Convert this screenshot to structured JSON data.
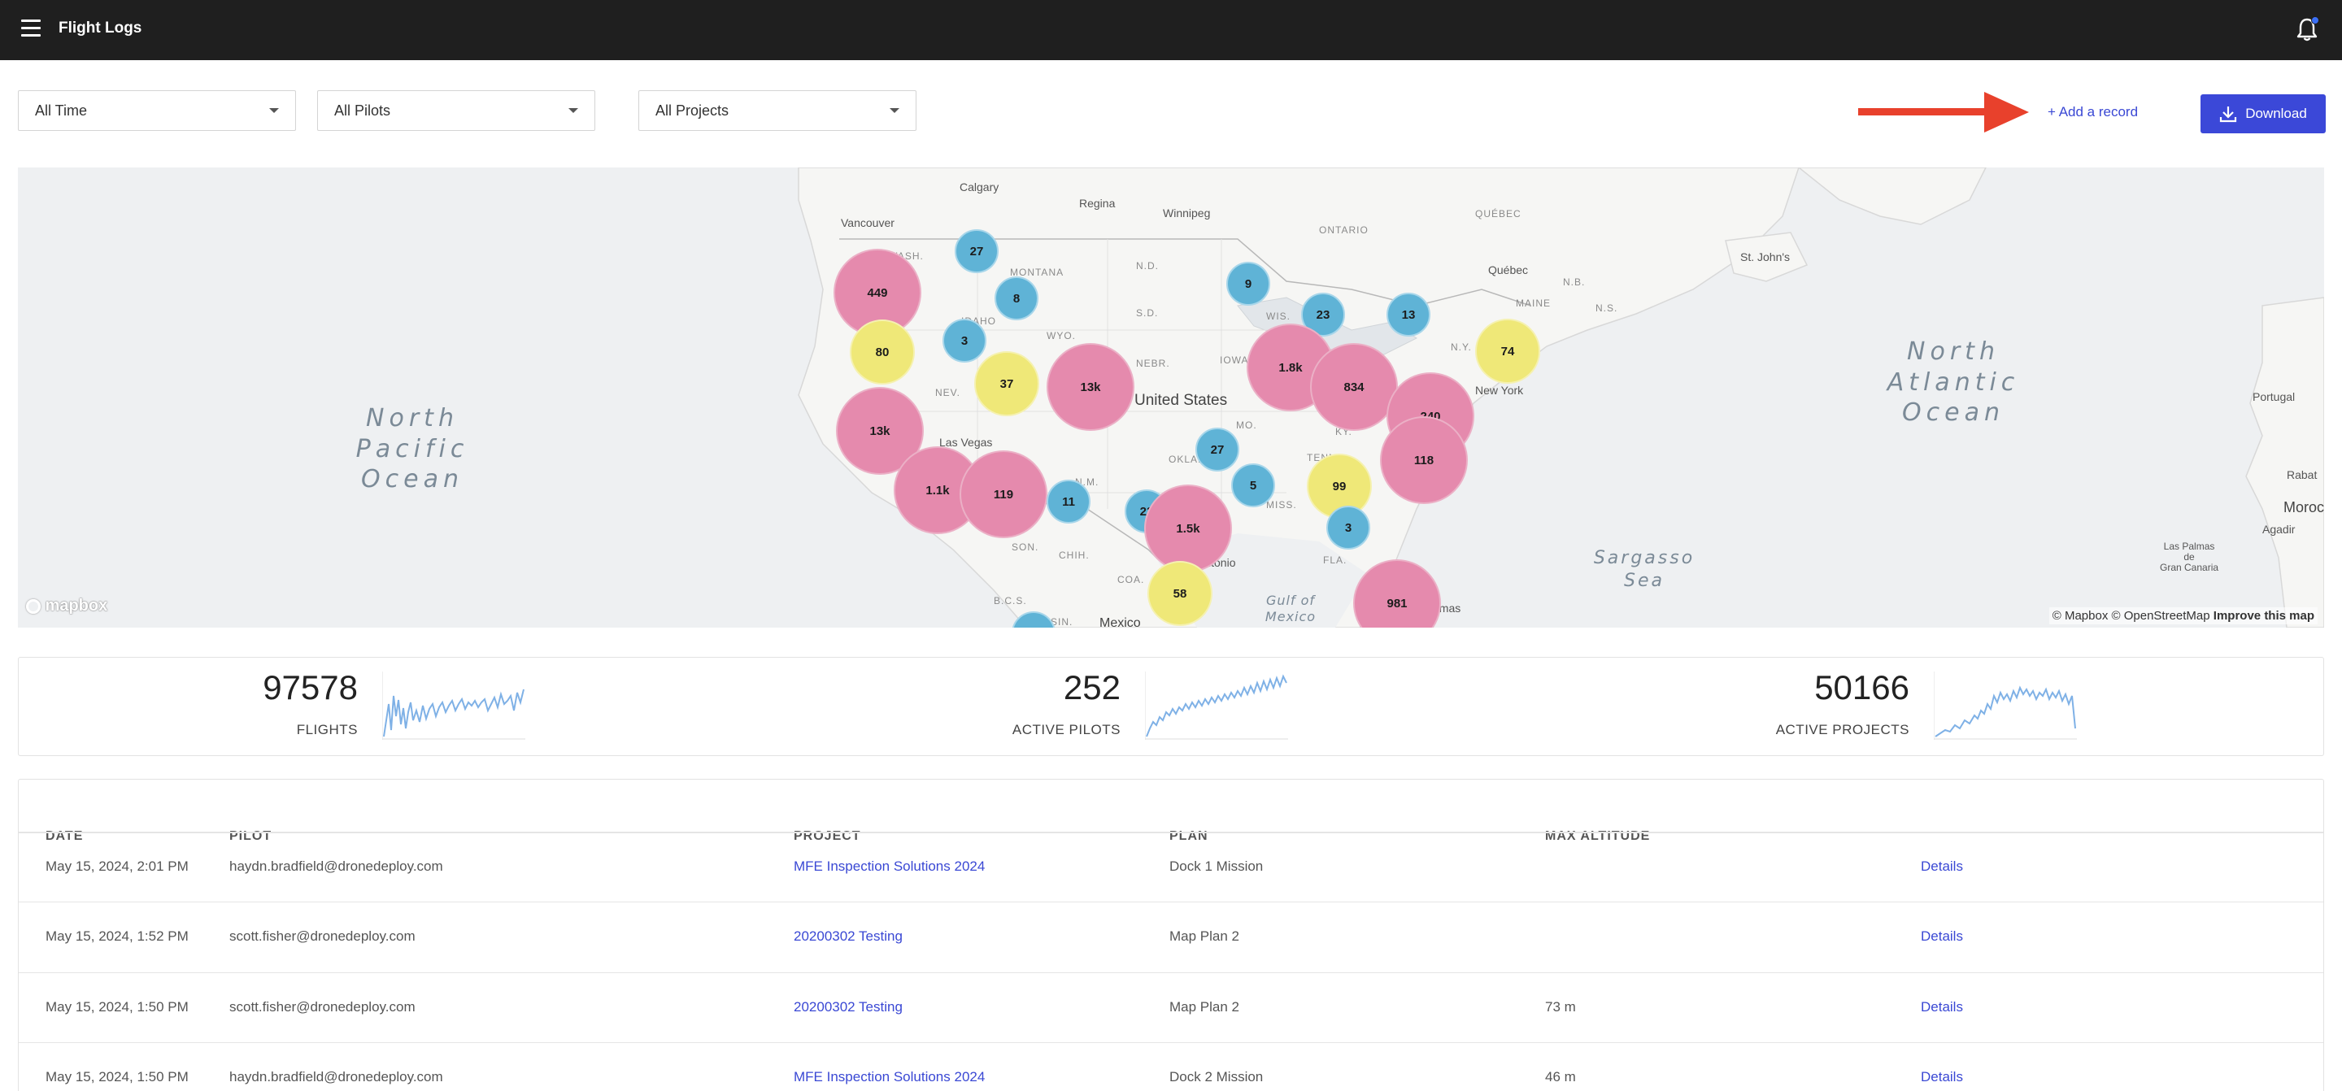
{
  "header": {
    "title": "Flight Logs"
  },
  "filters": {
    "time": "All Time",
    "pilots": "All Pilots",
    "projects": "All Projects"
  },
  "actions": {
    "add_record": "+ Add a record",
    "download": "Download"
  },
  "map": {
    "ocean_labels": {
      "pacific": "North\nPacific\nOcean",
      "atlantic": "North\nAtlantic\nOcean",
      "sargasso": "Sargasso\nSea",
      "gulf": "Gulf of\nMexico"
    },
    "places": {
      "calgary": "Calgary",
      "regina": "Regina",
      "winnipeg": "Winnipeg",
      "ontario": "ONTARIO",
      "quebec": "QUÉBEC",
      "quebec_city": "Québec",
      "nb": "N.B.",
      "maine": "MAINE",
      "ns": "N.S.",
      "st_johns": "St. John's",
      "vancouver": "Vancouver",
      "wash": "WASH.",
      "montana": "MONTANA",
      "nd": "N.D.",
      "sd": "S.D.",
      "wis": "WIS.",
      "idaho": "IDAHO",
      "wyo": "WYO.",
      "nebr": "NEBR.",
      "iowa": "IOWA",
      "ny": "N.Y.",
      "new_york": "New York",
      "nev": "NEV.",
      "united_states": "United States",
      "mo": "MO.",
      "ky": "KY.",
      "las_vegas": "Las Vegas",
      "okla": "OKLA.",
      "tenn": "TENN.",
      "nm": "N.M.",
      "miss": "MISS.",
      "son": "SON.",
      "chih": "CHIH.",
      "antonio": "Antonio",
      "fla": "FLA.",
      "coa": "COA.",
      "bcs": "B.C.S.",
      "sin": "SIN.",
      "mexico": "Mexico",
      "amas": "amas",
      "portugal": "Portugal",
      "rabat": "Rabat",
      "moroc": "Moroc",
      "agadir": "Agadir",
      "las_palmas": "Las Palmas\nde\nGran Canaria"
    },
    "clusters": {
      "c1": "27",
      "c2": "449",
      "c3": "8",
      "c4": "9",
      "c5": "23",
      "c6": "13",
      "c7": "80",
      "c8": "3",
      "c9": "37",
      "c10": "13k",
      "c11": "1.8k",
      "c12": "834",
      "c13": "74",
      "c14": "13k",
      "c15": "240",
      "c16": "27",
      "c17": "1.1k",
      "c18": "119",
      "c19": "11",
      "c20": "5",
      "c21": "99",
      "c22": "118",
      "c23": "23",
      "c24": "1.5k",
      "c25": "3",
      "c26": "58",
      "c27": "981"
    },
    "logo": "mapbox",
    "attribution_mapbox": "© Mapbox",
    "attribution_osm": "© OpenStreetMap",
    "attribution_improve": "Improve this map"
  },
  "stats": {
    "flights_value": "97578",
    "flights_label": "FLIGHTS",
    "pilots_value": "252",
    "pilots_label": "ACTIVE PILOTS",
    "projects_value": "50166",
    "projects_label": "ACTIVE PROJECTS"
  },
  "table": {
    "columns": {
      "date": "DATE",
      "pilot": "PILOT",
      "project": "PROJECT",
      "plan": "PLAN",
      "max_altitude": "MAX ALTITUDE"
    },
    "details_label": "Details",
    "rows": [
      {
        "date": "May 15, 2024, 2:01 PM",
        "pilot": "haydn.bradfield@dronedeploy.com",
        "project": "MFE Inspection Solutions 2024",
        "plan": "Dock 1 Mission",
        "altitude": ""
      },
      {
        "date": "May 15, 2024, 1:52 PM",
        "pilot": "scott.fisher@dronedeploy.com",
        "project": "20200302 Testing",
        "plan": "Map Plan 2",
        "altitude": ""
      },
      {
        "date": "May 15, 2024, 1:50 PM",
        "pilot": "scott.fisher@dronedeploy.com",
        "project": "20200302 Testing",
        "plan": "Map Plan 2",
        "altitude": "73 m"
      },
      {
        "date": "May 15, 2024, 1:50 PM",
        "pilot": "haydn.bradfield@dronedeploy.com",
        "project": "MFE Inspection Solutions 2024",
        "plan": "Dock 2 Mission",
        "altitude": "46 m"
      }
    ]
  },
  "colors": {
    "topbar": "#1f1f1f",
    "accent": "#3b48d8",
    "link": "#3a48d4",
    "arrow": "#e8412c",
    "cluster_pink": "#e58aad",
    "cluster_blue": "#5fb3d6",
    "cluster_yellow": "#efe878",
    "sparkline": "#7fb1e6"
  }
}
